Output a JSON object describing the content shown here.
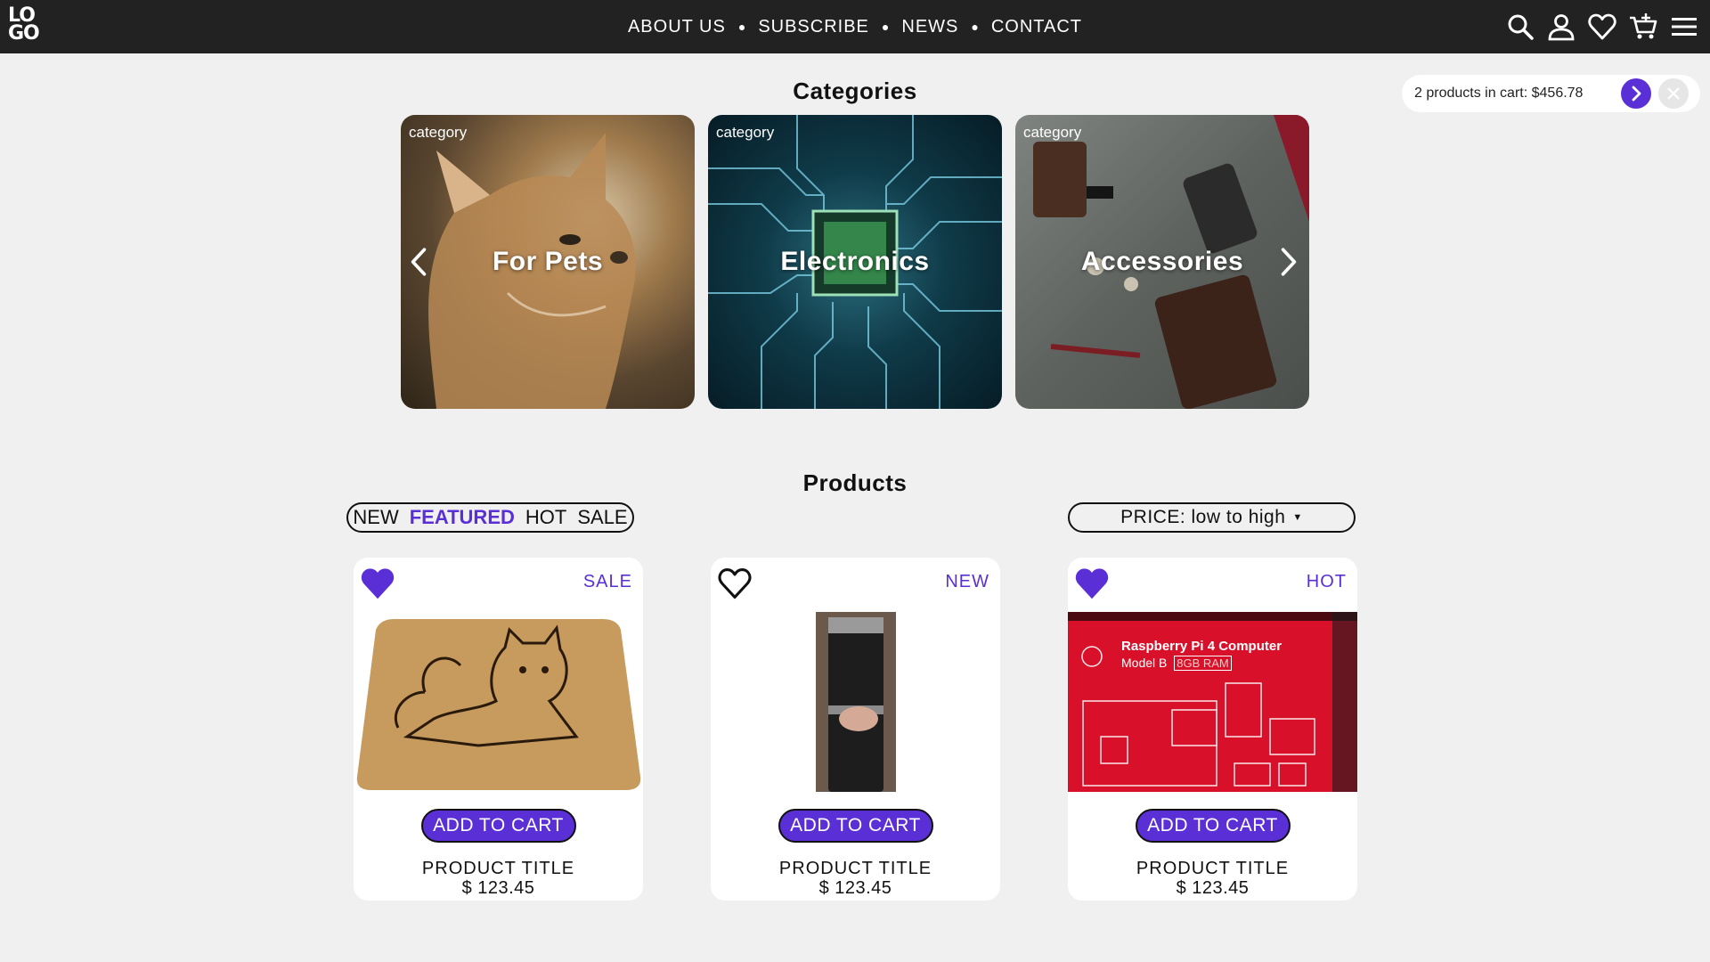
{
  "header": {
    "logo_line1": "LO",
    "logo_line2": "GO",
    "nav": [
      {
        "label": "ABOUT US"
      },
      {
        "label": "SUBSCRIBE"
      },
      {
        "label": "NEWS"
      },
      {
        "label": "CONTACT"
      }
    ],
    "icons": [
      "search-icon",
      "user-icon",
      "heart-icon",
      "cart-icon",
      "menu-icon"
    ]
  },
  "cart_notice": {
    "text": "2 products in cart: $456.78"
  },
  "categories": {
    "heading": "Categories",
    "items": [
      {
        "tag": "category",
        "title": "For Pets"
      },
      {
        "tag": "category",
        "title": "Electronics"
      },
      {
        "tag": "category",
        "title": "Accessories"
      }
    ]
  },
  "products": {
    "heading": "Products",
    "filters": [
      {
        "label": "NEW",
        "active": false
      },
      {
        "label": "FEATURED",
        "active": true
      },
      {
        "label": "HOT",
        "active": false
      },
      {
        "label": "SALE",
        "active": false
      }
    ],
    "sort_label": "PRICE: low to high",
    "items": [
      {
        "badge": "SALE",
        "favorited": true,
        "button": "ADD TO CART",
        "title": "PRODUCT TITLE",
        "price": "$ 123.45",
        "box_line1": "",
        "box_line2": ""
      },
      {
        "badge": "NEW",
        "favorited": false,
        "button": "ADD TO CART",
        "title": "PRODUCT TITLE",
        "price": "$ 123.45",
        "box_line1": "",
        "box_line2": ""
      },
      {
        "badge": "HOT",
        "favorited": true,
        "button": "ADD TO CART",
        "title": "PRODUCT TITLE",
        "price": "$ 123.45",
        "box_line1": "Raspberry Pi 4 Computer",
        "box_line2": "Model B",
        "box_ram": "8GB RAM"
      }
    ]
  },
  "colors": {
    "accent": "#5b2fd6",
    "topbar": "#222222",
    "background": "#f0f0f0"
  }
}
